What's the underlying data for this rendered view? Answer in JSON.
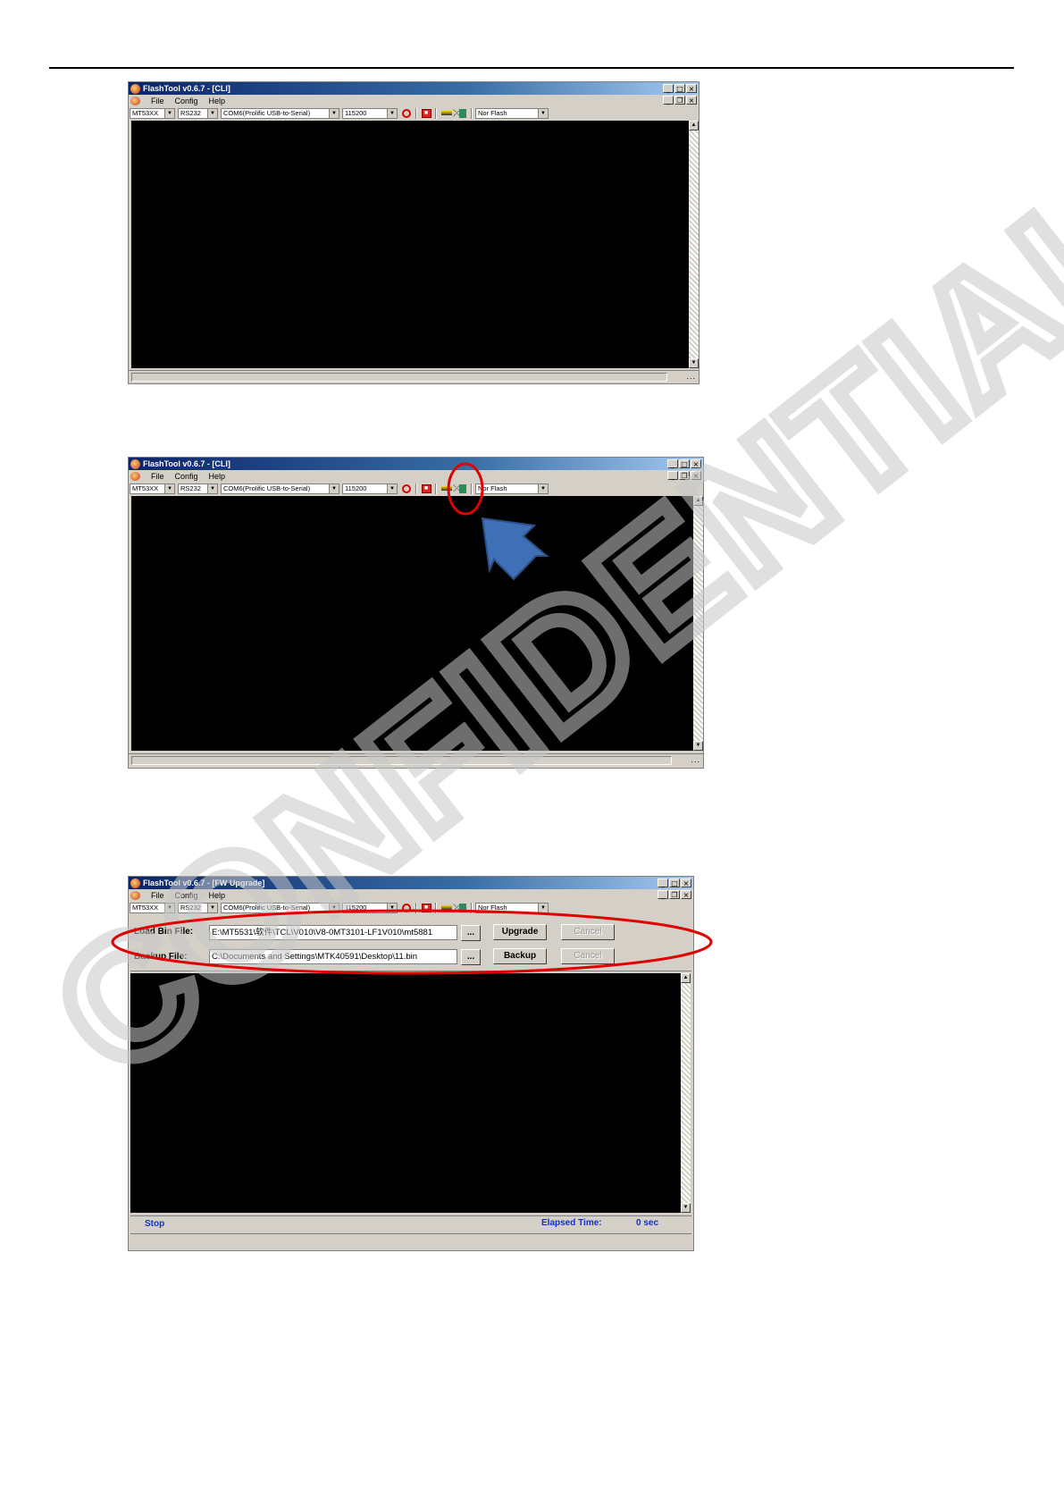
{
  "app": {
    "title_cli": "FlashTool v0.6.7 - [CLI]",
    "title_fw": "FlashTool v0.6.7 - [FW Upgrade]",
    "window_buttons": [
      "_",
      "□",
      "×"
    ],
    "mdi_buttons": [
      "_",
      "❐",
      "×"
    ]
  },
  "menu": {
    "file": "File",
    "config": "Config",
    "help": "Help"
  },
  "toolbar": {
    "chip": "MT53XX",
    "interface": "RS232",
    "port": "COM6(Prolific USB-to-Serial)",
    "baud": "115200",
    "flash_type": "Nor Flash",
    "dropdown_arrow": "▼"
  },
  "fw_upgrade": {
    "load_label": "Load Bin File:",
    "load_path": "E:\\MT5531\\软件\\TCL\\V010\\V8-0MT3101-LF1V010\\mt5881",
    "backup_label": "Backup File:",
    "backup_path": "C:\\Documents and Settings\\MTK40591\\Desktop\\11.bin",
    "browse": "...",
    "upgrade": "Upgrade",
    "backup": "Backup",
    "cancel": "Cancel"
  },
  "status": {
    "state": "Stop",
    "elapsed_label": "Elapsed Time:",
    "elapsed_value": "0 sec",
    "grip": "..."
  },
  "scroll": {
    "up": "▲",
    "down": "▼"
  },
  "watermark": "CONFIDENTIAL",
  "colors": {
    "annotation_red": "#e00000",
    "arrow_blue": "#3f6fb5",
    "status_blue": "#1030d0"
  }
}
